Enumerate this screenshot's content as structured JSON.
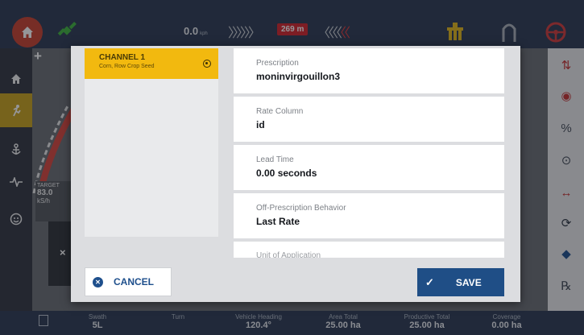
{
  "topbar": {
    "speed_value": "0.0",
    "speed_unit": "kph",
    "distance_badge": "269 m",
    "icons": [
      "home-icon",
      "gps-satellite-icon",
      "implement-icon",
      "arch-icon",
      "steering-wheel-icon"
    ]
  },
  "map": {
    "target_label": "TARGET",
    "target_value": "83.0",
    "target_unit": "kS/h"
  },
  "modal": {
    "channel": {
      "title": "CHANNEL 1",
      "subtitle": "Corn, Row Crop Seed"
    },
    "fields": [
      {
        "label": "Prescription",
        "value": "moninvirgouillon3"
      },
      {
        "label": "Rate Column",
        "value": "id"
      },
      {
        "label": "Lead Time",
        "value": "0.00 seconds"
      },
      {
        "label": "Off-Prescription Behavior",
        "value": "Last Rate"
      },
      {
        "label": "Unit of Application",
        "value": ""
      }
    ],
    "cancel_label": "CANCEL",
    "save_label": "SAVE"
  },
  "bottombar": {
    "stats": [
      {
        "label": "Swath",
        "value": "5L"
      },
      {
        "label": "Turn",
        "value": ""
      },
      {
        "label": "Vehicle Heading",
        "value": "120.4°"
      },
      {
        "label": "Area Total",
        "value": "25.00 ha"
      },
      {
        "label": "Productive Total",
        "value": "25.00 ha"
      },
      {
        "label": "Coverage",
        "value": "0.00 ha"
      }
    ]
  },
  "colors": {
    "accent_yellow": "#f2b90f",
    "primary_blue": "#1f4e86",
    "home_red": "#c8402e",
    "distance_red": "#d4232a"
  }
}
